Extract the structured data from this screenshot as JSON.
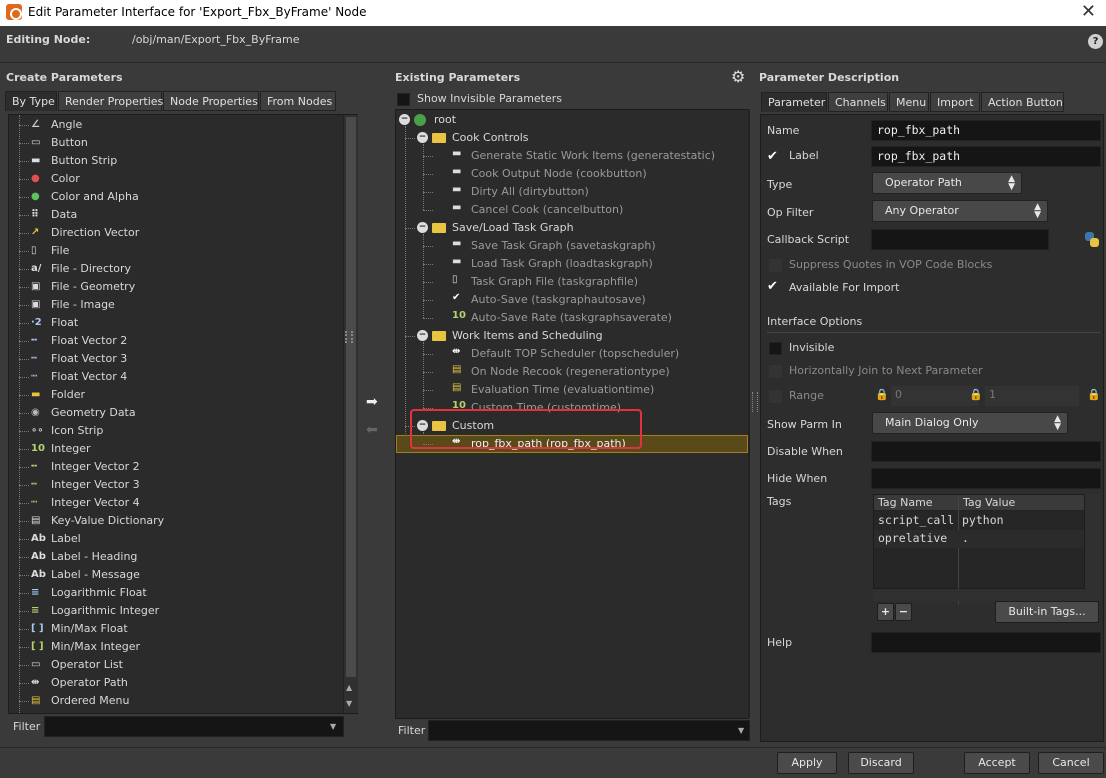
{
  "window": {
    "title": "Edit Parameter Interface for 'Export_Fbx_ByFrame' Node",
    "close": "✕"
  },
  "editing": {
    "label": "Editing Node:",
    "path": "/obj/man/Export_Fbx_ByFrame",
    "help": "?"
  },
  "create": {
    "title": "Create Parameters",
    "tabs": [
      "By Type",
      "Render Properties",
      "Node Properties",
      "From Nodes"
    ],
    "items": [
      "Angle",
      "Button",
      "Button Strip",
      "Color",
      "Color and Alpha",
      "Data",
      "Direction Vector",
      "File",
      "File - Directory",
      "File - Geometry",
      "File - Image",
      "Float",
      "Float Vector 2",
      "Float Vector 3",
      "Float Vector 4",
      "Folder",
      "Geometry Data",
      "Icon Strip",
      "Integer",
      "Integer Vector 2",
      "Integer Vector 3",
      "Integer Vector 4",
      "Key-Value Dictionary",
      "Label",
      "Label - Heading",
      "Label - Message",
      "Logarithmic Float",
      "Logarithmic Integer",
      "Min/Max Float",
      "Min/Max Integer",
      "Operator List",
      "Operator Path",
      "Ordered Menu"
    ],
    "filter_label": "Filter"
  },
  "existing": {
    "title": "Existing Parameters",
    "show_invisible": "Show Invisible Parameters",
    "root": "root",
    "folders": [
      {
        "name": "Cook Controls",
        "items": [
          "Generate Static Work Items (generatestatic)",
          "Cook Output Node (cookbutton)",
          "Dirty All (dirtybutton)",
          "Cancel Cook (cancelbutton)"
        ]
      },
      {
        "name": "Save/Load Task Graph",
        "items": [
          "Save Task Graph (savetaskgraph)",
          "Load Task Graph (loadtaskgraph)",
          "Task Graph File (taskgraphfile)",
          "Auto-Save (taskgraphautosave)",
          "Auto-Save Rate (taskgraphsaverate)"
        ]
      },
      {
        "name": "Work Items and Scheduling",
        "items": [
          "Default TOP Scheduler (topscheduler)",
          "On Node Recook (regenerationtype)",
          "Evaluation Time (evaluationtime)",
          "Custom Time (customtime)"
        ]
      },
      {
        "name": "Custom",
        "items": [
          "rop_fbx_path (rop_fbx_path)"
        ]
      }
    ],
    "filter_label": "Filter"
  },
  "desc": {
    "title": "Parameter Description",
    "tabs": [
      "Parameter",
      "Channels",
      "Menu",
      "Import",
      "Action Button"
    ],
    "name_label": "Name",
    "name_value": "rop_fbx_path",
    "label_label": "Label",
    "label_value": "rop_fbx_path",
    "type_label": "Type",
    "type_value": "Operator Path",
    "opfilter_label": "Op Filter",
    "opfilter_value": "Any Operator",
    "callback_label": "Callback Script",
    "suppress_label": "Suppress Quotes in VOP Code Blocks",
    "available_label": "Available For Import",
    "interface_label": "Interface Options",
    "invisible_label": "Invisible",
    "hjoin_label": "Horizontally Join to Next Parameter",
    "range_label": "Range",
    "range_min": "0",
    "range_max": "1",
    "showparm_label": "Show Parm In",
    "showparm_value": "Main Dialog Only",
    "disable_label": "Disable When",
    "hide_label": "Hide When",
    "tags_label": "Tags",
    "tags_headers": [
      "Tag Name",
      "Tag Value"
    ],
    "tags_rows": [
      [
        "script_call",
        "python"
      ],
      [
        "oprelative",
        "."
      ]
    ],
    "add": "+",
    "remove": "−",
    "builtin_label": "Built-in Tags...",
    "help_label": "Help"
  },
  "buttons": {
    "apply": "Apply",
    "discard": "Discard",
    "accept": "Accept",
    "cancel": "Cancel"
  },
  "colors": {
    "highlight": "#e0333b",
    "selrow": "#5a4a1a",
    "folder": "#e8c440",
    "intlabel": "#b5d36c"
  }
}
